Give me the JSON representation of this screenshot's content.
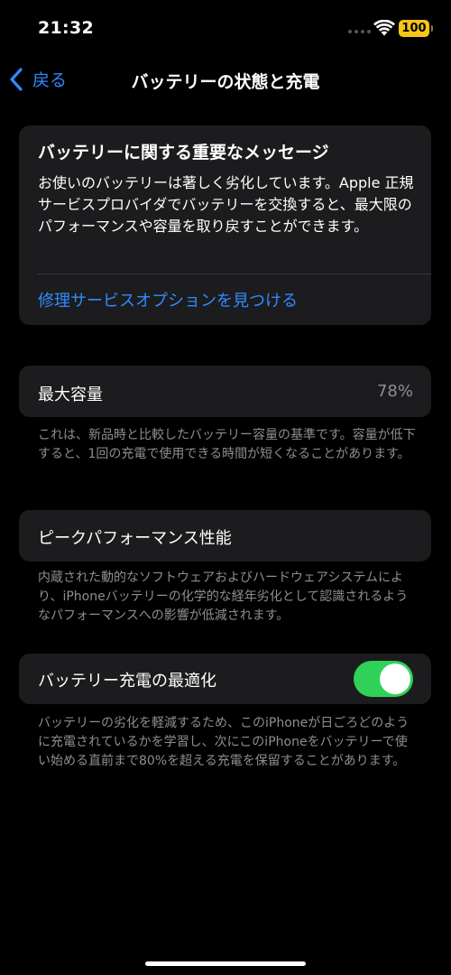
{
  "status": {
    "time": "21:32",
    "battery": "100"
  },
  "nav": {
    "back_label": "戻る",
    "title": "バッテリーの状態と充電"
  },
  "message": {
    "title": "バッテリーに関する重要なメッセージ",
    "body": "お使いのバッテリーは著しく劣化しています。Apple 正規サービスプロバイダでバッテリーを交換すると、最大限のパフォーマンスや容量を取り戻すことができます。",
    "link": "修理サービスオプションを見つける"
  },
  "capacity": {
    "label": "最大容量",
    "value": "78%",
    "footnote": "これは、新品時と比較したバッテリー容量の基準です。容量が低下すると、1回の充電で使用できる時間が短くなることがあります。"
  },
  "peak": {
    "label": "ピークパフォーマンス性能",
    "footnote": "内蔵された動的なソフトウェアおよびハードウェアシステムにより、iPhoneバッテリーの化学的な経年劣化として認識されるようなパフォーマンスへの影響が低減されます。"
  },
  "optimize": {
    "label": "バッテリー充電の最適化",
    "enabled": true,
    "footnote": "バッテリーの劣化を軽減するため、このiPhoneが日ごろどのように充電されているかを学習し、次にこのiPhoneをバッテリーで使い始める直前まで80%を超える充電を保留することがあります。"
  },
  "colors": {
    "background": "#000000",
    "card": "#1c1c1e",
    "accent": "#2f8bff",
    "toggle_on": "#30d158",
    "secondary_text": "#8e8e93",
    "battery": "#f5c518"
  }
}
